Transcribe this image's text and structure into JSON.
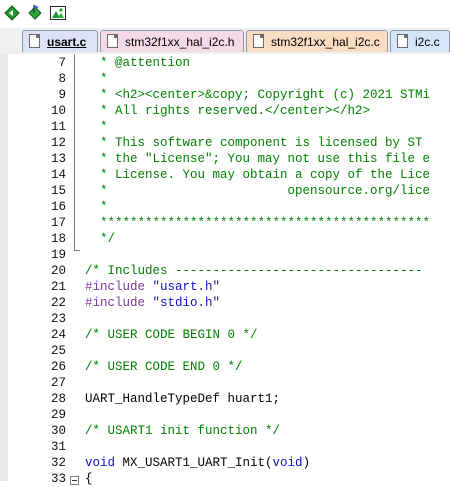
{
  "toolbar": {
    "icons": [
      "green-diamond-arrow-icon",
      "green-diamond-flag-icon",
      "green-landscape-icon"
    ]
  },
  "tabs": [
    {
      "label": "usart.c",
      "active": true,
      "color": "#dde3f4"
    },
    {
      "label": "stm32f1xx_hal_i2c.h",
      "active": false,
      "color": "#f6d9e6"
    },
    {
      "label": "stm32f1xx_hal_i2c.c",
      "active": false,
      "color": "#f9dcc2"
    },
    {
      "label": "i2c.c",
      "active": false,
      "color": "#d4e6f7"
    }
  ],
  "editor": {
    "lines": [
      {
        "num": "7",
        "segments": [
          {
            "cls": "cm",
            "text": "  * @attention"
          }
        ]
      },
      {
        "num": "8",
        "segments": [
          {
            "cls": "cm",
            "text": "  *"
          }
        ]
      },
      {
        "num": "9",
        "segments": [
          {
            "cls": "cm",
            "text": "  * <h2><center>&copy; Copyright (c) 2021 STMi"
          }
        ]
      },
      {
        "num": "10",
        "segments": [
          {
            "cls": "cm",
            "text": "  * All rights reserved.</center></h2>"
          }
        ]
      },
      {
        "num": "11",
        "segments": [
          {
            "cls": "cm",
            "text": "  *"
          }
        ]
      },
      {
        "num": "12",
        "segments": [
          {
            "cls": "cm",
            "text": "  * This software component is licensed by ST "
          }
        ]
      },
      {
        "num": "13",
        "segments": [
          {
            "cls": "cm",
            "text": "  * the \"License\"; You may not use this file e"
          }
        ]
      },
      {
        "num": "14",
        "segments": [
          {
            "cls": "cm",
            "text": "  * License. You may obtain a copy of the Lice"
          }
        ]
      },
      {
        "num": "15",
        "segments": [
          {
            "cls": "cm",
            "text": "  *                        opensource.org/lice"
          }
        ]
      },
      {
        "num": "16",
        "segments": [
          {
            "cls": "cm",
            "text": "  *"
          }
        ]
      },
      {
        "num": "17",
        "segments": [
          {
            "cls": "cm",
            "text": "  ********************************************"
          }
        ]
      },
      {
        "num": "18",
        "segments": [
          {
            "cls": "cm",
            "text": "  */"
          }
        ]
      },
      {
        "num": "19",
        "segments": []
      },
      {
        "num": "20",
        "segments": [
          {
            "cls": "cm",
            "text": "/* Includes ---------------------------------"
          }
        ]
      },
      {
        "num": "21",
        "segments": [
          {
            "cls": "pp",
            "text": "#include "
          },
          {
            "cls": "st",
            "text": "\"usart.h\""
          }
        ]
      },
      {
        "num": "22",
        "segments": [
          {
            "cls": "pp",
            "text": "#include "
          },
          {
            "cls": "st",
            "text": "\"stdio.h\""
          }
        ]
      },
      {
        "num": "23",
        "segments": []
      },
      {
        "num": "24",
        "segments": [
          {
            "cls": "cm",
            "text": "/* USER CODE BEGIN 0 */"
          }
        ]
      },
      {
        "num": "25",
        "segments": []
      },
      {
        "num": "26",
        "segments": [
          {
            "cls": "cm",
            "text": "/* USER CODE END 0 */"
          }
        ]
      },
      {
        "num": "27",
        "segments": []
      },
      {
        "num": "28",
        "segments": [
          {
            "cls": "pl",
            "text": "UART_HandleTypeDef huart1;"
          }
        ]
      },
      {
        "num": "29",
        "segments": []
      },
      {
        "num": "30",
        "segments": [
          {
            "cls": "cm",
            "text": "/* USART1 init function */"
          }
        ]
      },
      {
        "num": "31",
        "segments": []
      },
      {
        "num": "32",
        "segments": [
          {
            "cls": "kw",
            "text": "void"
          },
          {
            "cls": "pl",
            "text": " MX_USART1_UART_Init("
          },
          {
            "cls": "kw",
            "text": "void"
          },
          {
            "cls": "pl",
            "text": ")"
          }
        ]
      },
      {
        "num": "33",
        "segments": [
          {
            "cls": "pl",
            "text": "{"
          }
        ]
      }
    ]
  }
}
